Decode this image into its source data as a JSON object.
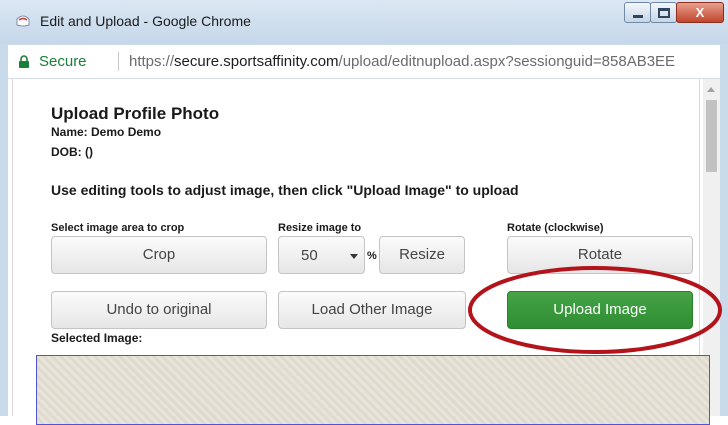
{
  "window": {
    "title": "Edit and Upload - Google Chrome",
    "close_glyph": "X",
    "minimize_icon": "minimize-icon",
    "maximize_icon": "maximize-icon",
    "close_icon": "close-icon",
    "app_icon": "chrome-icon"
  },
  "address_bar": {
    "secure_label": "Secure",
    "url_scheme": "https://",
    "url_host": "secure.sportsaffinity.com",
    "url_path": "/upload/editnupload.aspx?sessionguid=858AB3EE",
    "lock_icon": "lock-icon"
  },
  "page": {
    "title": "Upload Profile Photo",
    "name_line": "Name: Demo Demo",
    "dob_line": "DOB: ()",
    "instructions": "Use editing tools to adjust image, then click \"Upload Image\" to upload",
    "crop": {
      "label": "Select image area to crop",
      "button": "Crop"
    },
    "resize": {
      "label": "Resize image to",
      "value": "50",
      "unit": "%",
      "button": "Resize"
    },
    "rotate": {
      "label": "Rotate (clockwise)",
      "button": "Rotate"
    },
    "undo_button": "Undo to original",
    "load_other_button": "Load Other Image",
    "upload_button": "Upload Image",
    "selected_image_label": "Selected Image:"
  },
  "colors": {
    "upload_button": "#3a9a3c",
    "highlight_ellipse": "#b3141c",
    "secure_text": "#188038"
  }
}
